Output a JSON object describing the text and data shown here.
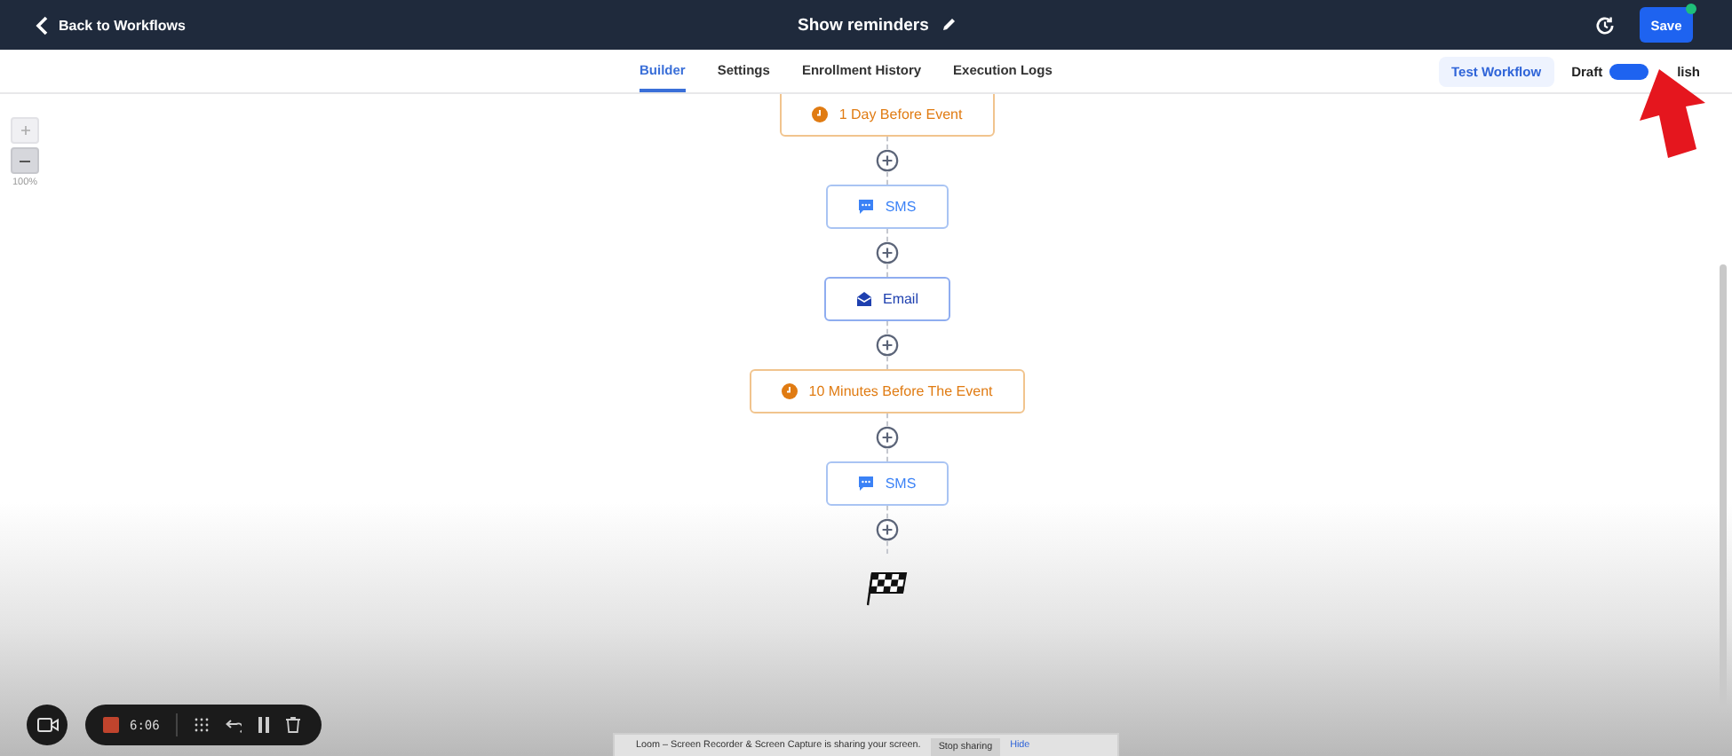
{
  "header": {
    "back_label": "Back to Workflows",
    "title": "Show reminders",
    "save_label": "Save",
    "save_badge": true
  },
  "tabs": [
    {
      "label": "Builder",
      "selected": true
    },
    {
      "label": "Settings",
      "selected": false
    },
    {
      "label": "Enrollment History",
      "selected": false
    },
    {
      "label": "Execution Logs",
      "selected": false
    }
  ],
  "test_button": "Test Workflow",
  "status_toggle": {
    "left_label": "Draft",
    "right_label": "lish",
    "on": true
  },
  "zoom": {
    "level_label": "100%"
  },
  "steps": [
    {
      "kind": "delay",
      "label": "1 Day Before Event"
    },
    {
      "kind": "sms",
      "label": "SMS"
    },
    {
      "kind": "email",
      "label": "Email"
    },
    {
      "kind": "delay",
      "label": "10 Minutes Before The Event"
    },
    {
      "kind": "sms",
      "label": "SMS"
    }
  ],
  "recorder": {
    "time": "6:06"
  },
  "share_bar": {
    "message": "Loom – Screen Recorder & Screen Capture is sharing your screen.",
    "stop_label": "Stop sharing",
    "hide_label": "Hide"
  }
}
